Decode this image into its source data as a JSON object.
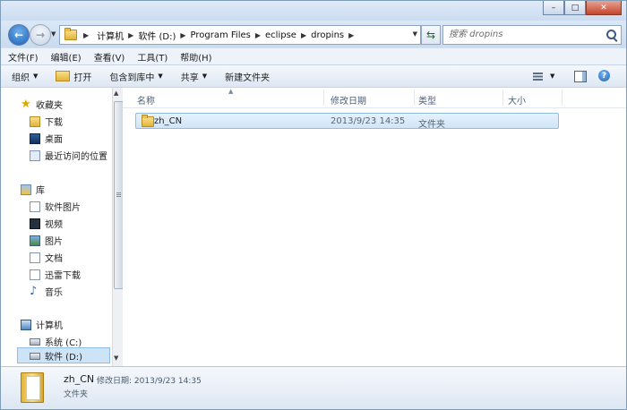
{
  "window": {
    "minimize_glyph": "–",
    "maximize_glyph": "□",
    "close_glyph": "✕"
  },
  "nav": {
    "back_glyph": "←",
    "forward_glyph": "→",
    "breadcrumb": [
      "计算机",
      "软件 (D:)",
      "Program Files",
      "eclipse",
      "dropins"
    ],
    "search_placeholder": "搜索 dropins"
  },
  "menu": [
    "文件(F)",
    "编辑(E)",
    "查看(V)",
    "工具(T)",
    "帮助(H)"
  ],
  "commands": {
    "organize": "组织",
    "open": "打开",
    "include_in_library": "包含到库中",
    "share": "共享",
    "new_folder": "新建文件夹",
    "help_glyph": "?"
  },
  "sidebar": {
    "favorites_label": "收藏夹",
    "favorites": [
      "下载",
      "桌面",
      "最近访问的位置"
    ],
    "libraries_label": "库",
    "libraries": [
      "软件图片",
      "视频",
      "图片",
      "文档",
      "迅雷下载",
      "音乐"
    ],
    "computer_label": "计算机",
    "drives": [
      "系统 (C:)",
      "软件 (D:)"
    ],
    "selected_drive": "软件 (D:)"
  },
  "columns": [
    "名称",
    "修改日期",
    "类型",
    "大小"
  ],
  "files": [
    {
      "name": "zh_CN",
      "modified": "2013/9/23 14:35",
      "type": "文件夹",
      "size": ""
    }
  ],
  "details": {
    "name": "zh_CN",
    "modified_label": "修改日期:",
    "modified": "2013/9/23 14:35",
    "type": "文件夹"
  },
  "colors": {
    "chrome": "#cfe0f2",
    "selection": "#cde4f7",
    "accent": "#1f63b3"
  }
}
